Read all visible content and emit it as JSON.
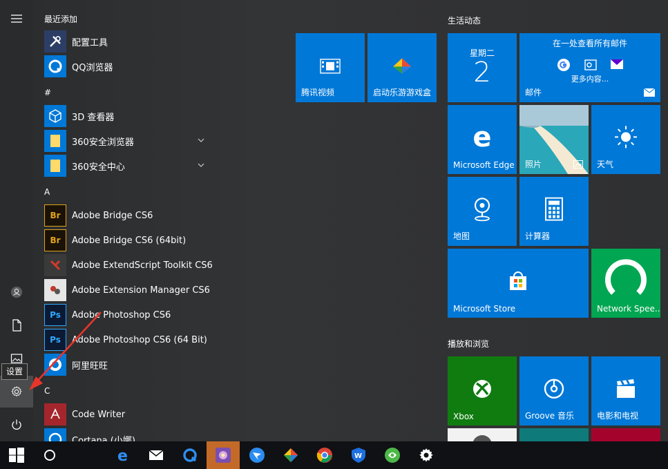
{
  "applist": {
    "sections": [
      {
        "header": "最近添加",
        "items": [
          {
            "label": "配置工具",
            "icon": "tools-icon"
          },
          {
            "label": "QQ浏览器",
            "icon": "qq-browser-icon"
          }
        ]
      },
      {
        "header": "#",
        "items": [
          {
            "label": "3D 查看器",
            "icon": "cube-icon"
          },
          {
            "label": "360安全浏览器",
            "icon": "folder-icon",
            "expandable": true
          },
          {
            "label": "360安全中心",
            "icon": "folder-icon",
            "expandable": true
          }
        ]
      },
      {
        "header": "A",
        "items": [
          {
            "label": "Adobe Bridge CS6",
            "icon": "adobe-bridge-icon"
          },
          {
            "label": "Adobe Bridge CS6 (64bit)",
            "icon": "adobe-bridge-icon"
          },
          {
            "label": "Adobe ExtendScript Toolkit CS6",
            "icon": "extendscript-icon"
          },
          {
            "label": "Adobe Extension Manager CS6",
            "icon": "extension-manager-icon"
          },
          {
            "label": "Adobe Photoshop CS6",
            "icon": "photoshop-icon"
          },
          {
            "label": "Adobe Photoshop CS6 (64 Bit)",
            "icon": "photoshop-icon"
          },
          {
            "label": "阿里旺旺",
            "icon": "aliwangwang-icon"
          }
        ]
      },
      {
        "header": "C",
        "items": [
          {
            "label": "Code Writer",
            "icon": "code-writer-icon"
          },
          {
            "label": "Cortana (小娜)",
            "icon": "cortana-icon"
          }
        ]
      }
    ]
  },
  "rail": {
    "tooltip": "设置"
  },
  "groups": {
    "life": "生活动态",
    "play": "播放和浏览"
  },
  "tiles": {
    "tencent_video": "腾讯视频",
    "game_box": "启动乐游游戏盒",
    "calendar_weekday": "星期二",
    "calendar_day": "2",
    "mail_header": "在一处查看所有邮件",
    "mail_more": "更多内容...",
    "mail": "邮件",
    "edge": "Microsoft Edge",
    "photos": "照片",
    "weather": "天气",
    "maps": "地图",
    "calculator": "计算器",
    "store": "Microsoft Store",
    "network_speed": "Network Spee...",
    "xbox": "Xbox",
    "groove": "Groove 音乐",
    "movies": "电影和电视"
  },
  "colors": {
    "accent": "#0078d7",
    "xbox": "#107c10",
    "network": "#00a651",
    "taskbar": "#101114",
    "arrow": "#e8352b"
  }
}
